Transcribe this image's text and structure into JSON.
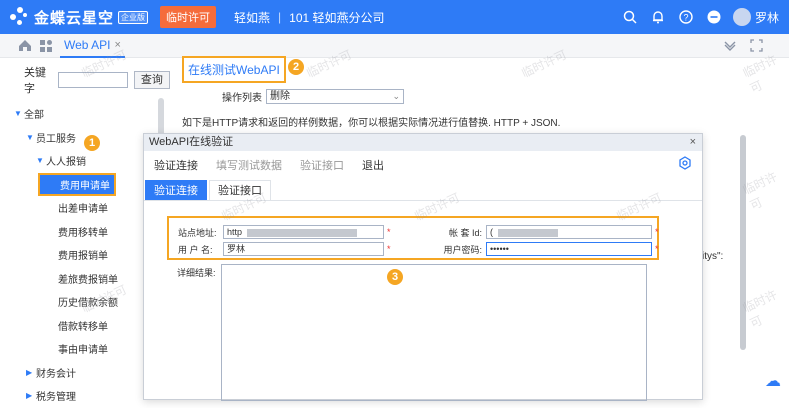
{
  "topbar": {
    "logo_text": "金蝶云星空",
    "edition_badge": "企业版",
    "temp_license": "临时许可",
    "user_short": "轻如燕",
    "org_separator": "|",
    "org_name": "101 轻如燕分公司",
    "username": "罗林",
    "icons": [
      "search-icon",
      "bell-icon",
      "help-icon",
      "minus-circle-icon",
      "avatar"
    ]
  },
  "tabbar": {
    "home_icon": "home-icon",
    "grid_icon": "apps-icon",
    "active_tab": "Web API",
    "close": "×"
  },
  "sidebar": {
    "search_label": "关键字",
    "search_value": "",
    "search_button": "查询",
    "items": [
      {
        "label": "全部",
        "level": 0,
        "expanded": true
      },
      {
        "label": "员工服务",
        "level": 1,
        "expanded": true
      },
      {
        "label": "人人报销",
        "level": 2,
        "expanded": true
      },
      {
        "label": "费用申请单",
        "level": 3,
        "selected": true
      },
      {
        "label": "出差申请单",
        "level": 3
      },
      {
        "label": "费用移转单",
        "level": 3
      },
      {
        "label": "费用报销单",
        "level": 3
      },
      {
        "label": "差旅费报销单",
        "level": 3
      },
      {
        "label": "历史借款余额",
        "level": 3
      },
      {
        "label": "借款转移单",
        "level": 3
      },
      {
        "label": "事由申请单",
        "level": 3
      },
      {
        "label": "财务会计",
        "level": 1,
        "expanded": false
      },
      {
        "label": "税务管理",
        "level": 1,
        "expanded": false
      }
    ]
  },
  "main": {
    "online_test_title": "在线测试WebAPI",
    "op_list_label": "操作列表",
    "op_list_value": "删除",
    "description": "如下是HTTP请求和返回的样例数据，你可以根据实际情况进行值替换. HTTP + JSON.",
    "bg_fragment": "itys\":"
  },
  "badges": {
    "one": "1",
    "two": "2",
    "three": "3"
  },
  "modal": {
    "title": "WebAPI在线验证",
    "close": "×",
    "menu": [
      "验证连接",
      "填写测试数据",
      "验证接口",
      "退出"
    ],
    "menu_disabled": [
      false,
      true,
      true,
      false
    ],
    "tabs": [
      "验证连接",
      "验证接口"
    ],
    "active_tab": 0,
    "site_label": "站点地址:",
    "site_value": "http",
    "user_label": "用 户 名:",
    "user_value": "罗林",
    "account_label": "帐 套 Id:",
    "account_value": "(",
    "password_label": "用户密码:",
    "password_value": "••••••",
    "required_mark": "*",
    "detail_label": "详细结果:"
  },
  "watermark": "临时许可",
  "colors": {
    "brand": "#2e7bf6",
    "highlight": "#f5a623",
    "license": "#f56c3b"
  }
}
